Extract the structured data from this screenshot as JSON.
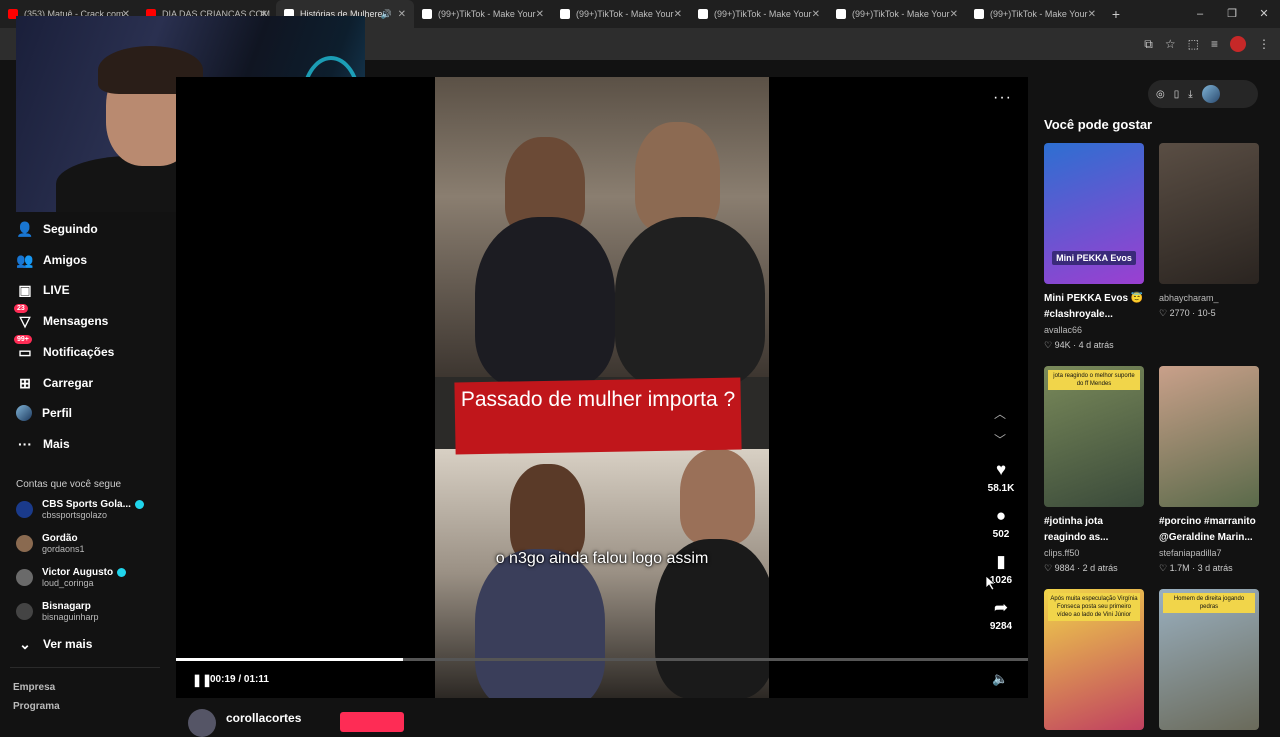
{
  "browser": {
    "tabs": [
      {
        "title": "(353) Matuê - Crack com",
        "favicon_color": "#ff0000",
        "active": false
      },
      {
        "title": "DIA DAS CRIANCAS COM",
        "favicon_color": "#ff0000",
        "active": false
      },
      {
        "title": "Histórias de Mulheres",
        "favicon_color": "#ffffff",
        "active": true
      },
      {
        "title": "(99+)TikTok - Make Your",
        "favicon_color": "#ffffff",
        "active": false
      },
      {
        "title": "(99+)TikTok - Make Your",
        "favicon_color": "#ffffff",
        "active": false
      },
      {
        "title": "(99+)TikTok - Make Your",
        "favicon_color": "#ffffff",
        "active": false
      },
      {
        "title": "(99+)TikTok - Make Your",
        "favicon_color": "#ffffff",
        "active": false
      },
      {
        "title": "(99+)TikTok - Make Your",
        "favicon_color": "#ffffff",
        "active": false
      }
    ],
    "new_tab_glyph": "+",
    "window_controls": [
      "–",
      "❐",
      "✕"
    ]
  },
  "sidebar": {
    "nav": [
      {
        "label": "Seguindo",
        "icon": "following-icon",
        "glyph": "👤"
      },
      {
        "label": "Amigos",
        "icon": "friends-icon",
        "glyph": "👥"
      },
      {
        "label": "LIVE",
        "icon": "live-icon",
        "glyph": "▣"
      },
      {
        "label": "Mensagens",
        "icon": "messages-icon",
        "glyph": "▽",
        "badge": "23"
      },
      {
        "label": "Notificações",
        "icon": "notifications-icon",
        "glyph": "▭",
        "badge": "99+"
      },
      {
        "label": "Carregar",
        "icon": "upload-icon",
        "glyph": "⊞"
      },
      {
        "label": "Perfil",
        "icon": "profile-avatar-icon",
        "glyph": ""
      },
      {
        "label": "Mais",
        "icon": "more-icon",
        "glyph": "···"
      }
    ],
    "following_header": "Contas que você segue",
    "accounts": [
      {
        "name": "CBS Sports Gola...",
        "handle": "cbssportsgolazo",
        "verified": true,
        "color": "#1a3a8a"
      },
      {
        "name": "Gordão",
        "handle": "gordaons1",
        "verified": false,
        "color": "#8a6a50"
      },
      {
        "name": "Victor Augusto",
        "handle": "loud_coringa",
        "verified": true,
        "color": "#6a6a6a"
      },
      {
        "name": "Bisnagarp",
        "handle": "bisnaguinharp",
        "verified": false,
        "color": "#444"
      }
    ],
    "see_more": "Ver mais",
    "footer_links": [
      "Empresa",
      "Programa"
    ]
  },
  "player": {
    "caption": "Passado de mulher importa ?",
    "subtitle": "o n3go ainda falou logo assim",
    "likes": "58.1K",
    "comments": "502",
    "saves": "1026",
    "shares": "9284",
    "time": "00:19 / 01:11",
    "progress": 0.267,
    "author": "corollacortes"
  },
  "recommend": {
    "title": "Você pode gostar",
    "cards": [
      {
        "title1": "Mini PEKKA Evos 😇",
        "title2": "#clashroyale...",
        "user": "avallac66",
        "meta": "♡ 94K · 4 d atrás",
        "thumb_label": "Mini PEKKA Evos",
        "colors": [
          "#2d6fd1",
          "#9b3fd1"
        ]
      },
      {
        "title1": "",
        "title2": "",
        "user": "abhaycharam_",
        "meta": "♡ 2770 · 10-5",
        "thumb_label": "",
        "colors": [
          "#5a4e44",
          "#2a2420"
        ]
      },
      {
        "title1": "#jotinha jota",
        "title2": "reagindo as...",
        "user": "clips.ff50",
        "meta": "♡ 9884 · 2 d atrás",
        "thumb_label": "jota reagindo o melhor suporte do ff Mendes",
        "colors": [
          "#7a8a5a",
          "#3a4a3a"
        ]
      },
      {
        "title1": "#porcino #marranito",
        "title2": "@Geraldine Marin...",
        "user": "stefaniapadilla7",
        "meta": "♡ 1.7M · 3 d atrás",
        "thumb_label": "",
        "colors": [
          "#c9a08a",
          "#5a6a4a"
        ]
      },
      {
        "title1": "",
        "title2": "",
        "user": "",
        "meta": "",
        "thumb_label": "Após muita especulação Virgínia Fonseca posta seu primeiro vídeo ao lado de Vini Júnior",
        "colors": [
          "#f1d54a",
          "#c04060"
        ]
      },
      {
        "title1": "",
        "title2": "",
        "user": "",
        "meta": "",
        "thumb_label": "Homem de direita jogando pedras",
        "colors": [
          "#9ab0c0",
          "#6a6a5a"
        ]
      }
    ]
  }
}
